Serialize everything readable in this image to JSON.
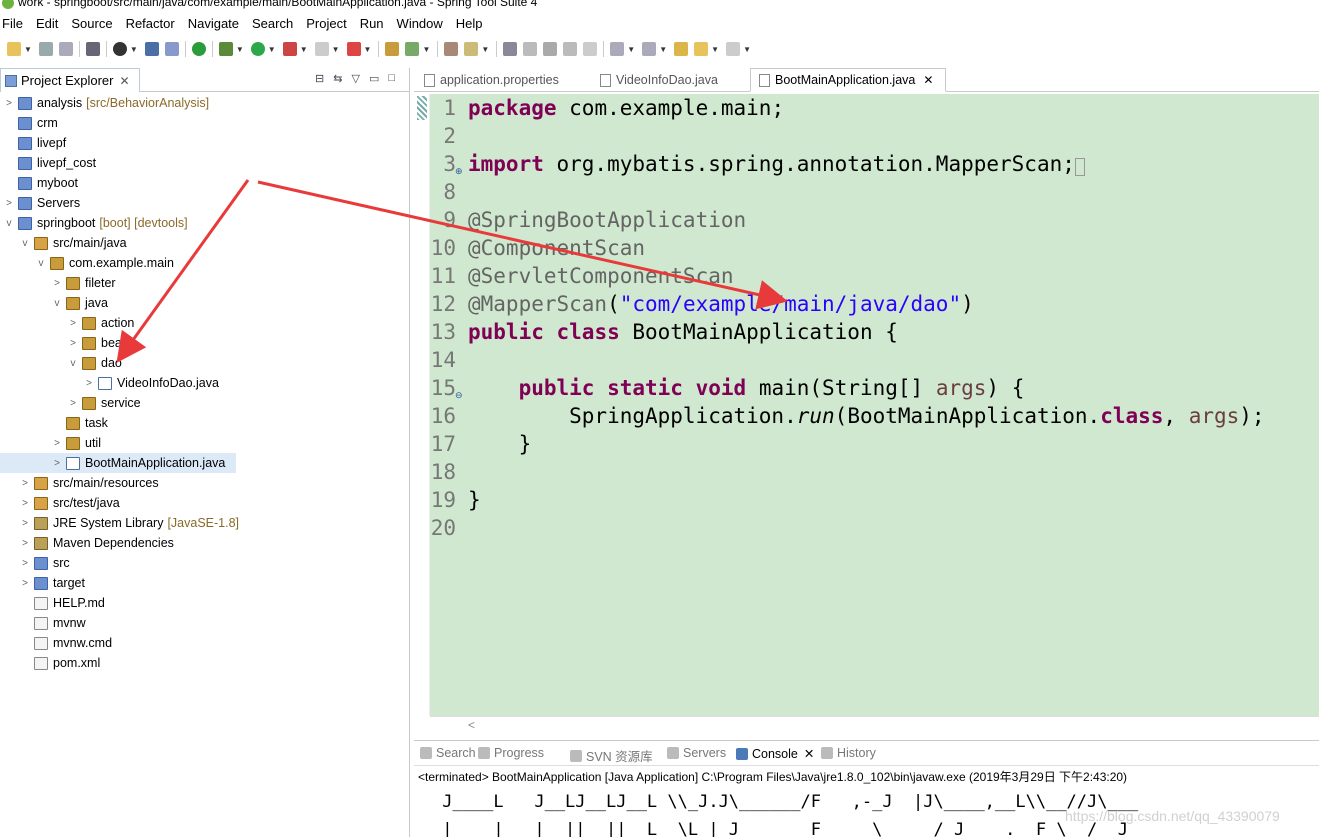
{
  "window": {
    "title": "work - springboot/src/main/java/com/example/main/BootMainApplication.java - Spring Tool Suite 4"
  },
  "menu": [
    "File",
    "Edit",
    "Source",
    "Refactor",
    "Navigate",
    "Search",
    "Project",
    "Run",
    "Window",
    "Help"
  ],
  "project_explorer": {
    "tab_label": "Project Explorer",
    "items": [
      {
        "label": "analysis",
        "decoration": "[src/BehaviorAnalysis]",
        "indent": 0,
        "twisty": ">",
        "icon": "project-icon"
      },
      {
        "label": "crm",
        "decoration": "",
        "indent": 0,
        "twisty": "",
        "icon": "folder-icon"
      },
      {
        "label": "livepf",
        "decoration": "",
        "indent": 0,
        "twisty": "",
        "icon": "folder-icon"
      },
      {
        "label": "livepf_cost",
        "decoration": "",
        "indent": 0,
        "twisty": "",
        "icon": "folder-icon"
      },
      {
        "label": "myboot",
        "decoration": "",
        "indent": 0,
        "twisty": "",
        "icon": "folder-icon"
      },
      {
        "label": "Servers",
        "decoration": "",
        "indent": 0,
        "twisty": ">",
        "icon": "folder-icon"
      },
      {
        "label": "springboot",
        "decoration": "[boot] [devtools]",
        "indent": 0,
        "twisty": "v",
        "icon": "project-icon"
      },
      {
        "label": "src/main/java",
        "decoration": "",
        "indent": 1,
        "twisty": "v",
        "icon": "source-folder-icon"
      },
      {
        "label": "com.example.main",
        "decoration": "",
        "indent": 2,
        "twisty": "v",
        "icon": "package-icon"
      },
      {
        "label": "fileter",
        "decoration": "",
        "indent": 3,
        "twisty": ">",
        "icon": "package-icon"
      },
      {
        "label": "java",
        "decoration": "",
        "indent": 3,
        "twisty": "v",
        "icon": "package-icon"
      },
      {
        "label": "action",
        "decoration": "",
        "indent": 4,
        "twisty": ">",
        "icon": "package-icon"
      },
      {
        "label": "bean",
        "decoration": "",
        "indent": 4,
        "twisty": ">",
        "icon": "package-icon"
      },
      {
        "label": "dao",
        "decoration": "",
        "indent": 4,
        "twisty": "v",
        "icon": "package-icon"
      },
      {
        "label": "VideoInfoDao.java",
        "decoration": "",
        "indent": 5,
        "twisty": ">",
        "icon": "java-interface-icon"
      },
      {
        "label": "service",
        "decoration": "",
        "indent": 4,
        "twisty": ">",
        "icon": "package-icon"
      },
      {
        "label": "task",
        "decoration": "",
        "indent": 3,
        "twisty": "",
        "icon": "package-icon"
      },
      {
        "label": "util",
        "decoration": "",
        "indent": 3,
        "twisty": ">",
        "icon": "package-icon"
      },
      {
        "label": "BootMainApplication.java",
        "decoration": "",
        "indent": 3,
        "twisty": ">",
        "icon": "java-file-icon",
        "selected": true
      },
      {
        "label": "src/main/resources",
        "decoration": "",
        "indent": 1,
        "twisty": ">",
        "icon": "source-folder-icon"
      },
      {
        "label": "src/test/java",
        "decoration": "",
        "indent": 1,
        "twisty": ">",
        "icon": "source-folder-icon"
      },
      {
        "label": "JRE System Library",
        "decoration": "[JavaSE-1.8]",
        "indent": 1,
        "twisty": ">",
        "icon": "library-icon"
      },
      {
        "label": "Maven Dependencies",
        "decoration": "",
        "indent": 1,
        "twisty": ">",
        "icon": "library-icon"
      },
      {
        "label": "src",
        "decoration": "",
        "indent": 1,
        "twisty": ">",
        "icon": "folder-icon"
      },
      {
        "label": "target",
        "decoration": "",
        "indent": 1,
        "twisty": ">",
        "icon": "folder-icon"
      },
      {
        "label": "HELP.md",
        "decoration": "",
        "indent": 1,
        "twisty": "",
        "icon": "file-icon"
      },
      {
        "label": "mvnw",
        "decoration": "",
        "indent": 1,
        "twisty": "",
        "icon": "file-icon"
      },
      {
        "label": "mvnw.cmd",
        "decoration": "",
        "indent": 1,
        "twisty": "",
        "icon": "file-icon"
      },
      {
        "label": "pom.xml",
        "decoration": "",
        "indent": 1,
        "twisty": "",
        "icon": "xml-file-icon"
      }
    ]
  },
  "editor": {
    "tabs": [
      {
        "label": "application.properties",
        "active": false
      },
      {
        "label": "VideoInfoDao.java",
        "active": false
      },
      {
        "label": "BootMainApplication.java",
        "active": true
      }
    ],
    "lines": [
      {
        "n": "1",
        "html": "<span class='kw'>package</span> com.example.main;"
      },
      {
        "n": "2",
        "html": ""
      },
      {
        "n": "3",
        "html": "<span class='kw'>import</span> org.mybatis.spring.annotation.MapperScan;<span style='border:1px solid #999;font-size:14px'>&nbsp;</span>",
        "fold": "+"
      },
      {
        "n": "8",
        "html": ""
      },
      {
        "n": "9",
        "html": "<span class='an'>@SpringBootApplication</span>"
      },
      {
        "n": "10",
        "html": "<span class='an'>@ComponentScan</span>"
      },
      {
        "n": "11",
        "html": "<span class='an'>@ServletComponentScan</span>"
      },
      {
        "n": "12",
        "html": "<span class='an'>@MapperScan</span>(<span class='st'>\"com/example/main/java/dao\"</span>)"
      },
      {
        "n": "13",
        "html": "<span class='kw'>public</span> <span class='kw'>class</span> BootMainApplication {"
      },
      {
        "n": "14",
        "html": ""
      },
      {
        "n": "15",
        "html": "    <span class='kw'>public</span> <span class='kw'>static</span> <span class='kw'>void</span> main(String[] <span class='ar'>args</span>) {",
        "fold": "-"
      },
      {
        "n": "16",
        "html": "        SpringApplication.<span class='it'>run</span>(BootMainApplication.<span class='kw'>class</span>, <span class='ar'>args</span>);"
      },
      {
        "n": "17",
        "html": "    }"
      },
      {
        "n": "18",
        "html": ""
      },
      {
        "n": "19",
        "html": "}"
      },
      {
        "n": "20",
        "html": ""
      }
    ]
  },
  "bottom_panel": {
    "tabs": [
      {
        "label": "Search",
        "active": false
      },
      {
        "label": "Progress",
        "active": false
      },
      {
        "label": "SVN 资源库",
        "active": false
      },
      {
        "label": "Servers",
        "active": false
      },
      {
        "label": "Console",
        "active": true
      },
      {
        "label": "History",
        "active": false
      }
    ],
    "console_header": "<terminated> BootMainApplication [Java Application] C:\\Program Files\\Java\\jre1.8.0_102\\bin\\javaw.exe (2019年3月29日 下午2:43:20)",
    "console_lines": [
      " J____L   J__LJ__LJ__L \\\\_J.J\\______/F   ,-_J  |J\\____,__L\\\\__//J\\___",
      " |    |   |  ||  ||  L  \\L | J       F     \\     / J    .  F \\  /  J"
    ]
  },
  "watermark": "https://blog.csdn.net/qq_43390079"
}
